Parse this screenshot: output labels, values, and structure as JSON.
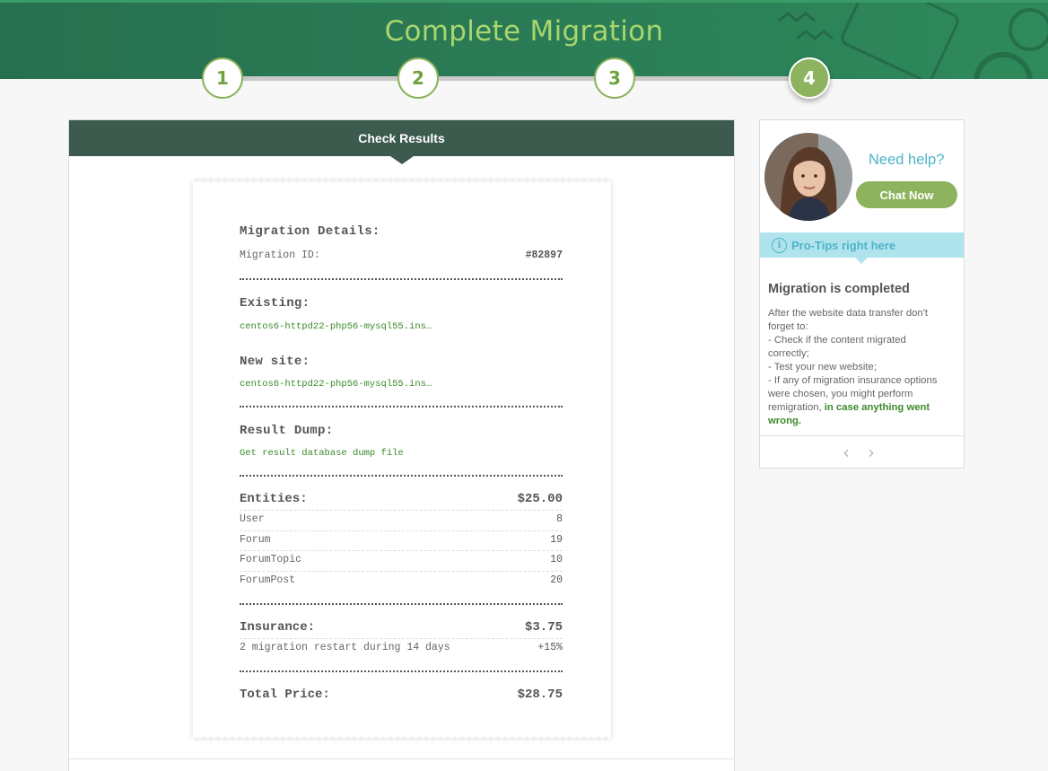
{
  "header": {
    "title": "Complete Migration"
  },
  "steps": [
    "1",
    "2",
    "3",
    "4"
  ],
  "panel": {
    "title": "Check Results"
  },
  "receipt": {
    "details_heading": "Migration Details:",
    "migration_id_label": "Migration ID:",
    "migration_id_value": "#82897",
    "existing_heading": "Existing:",
    "existing_link": "centos6-httpd22-php56-mysql55.ins…",
    "new_site_heading": "New site:",
    "new_site_link": "centos6-httpd22-php56-mysql55.ins…",
    "dump_heading": "Result Dump:",
    "dump_link": "Get result database dump file",
    "entities": {
      "label": "Entities:",
      "price": "$25.00",
      "rows": [
        {
          "name": "User",
          "count": "8"
        },
        {
          "name": "Forum",
          "count": "19"
        },
        {
          "name": "ForumTopic",
          "count": "10"
        },
        {
          "name": "ForumPost",
          "count": "20"
        }
      ]
    },
    "insurance": {
      "label": "Insurance:",
      "price": "$3.75",
      "detail": "2 migration restart during 14 days",
      "detail_value": "+15%"
    },
    "total": {
      "label": "Total Price:",
      "price": "$28.75"
    }
  },
  "sidebar": {
    "need_help": "Need help?",
    "chat_button": "Chat Now",
    "tips_label": "Pro-Tips right here",
    "tip_title": "Migration is completed",
    "tip_lines": [
      "After the website data transfer don't",
      "forget to:",
      "- Check if the content migrated",
      "correctly;",
      "- Test your new website;",
      "- If any of migration insurance options",
      "were chosen, you might perform"
    ],
    "tip_last_plain": "remigration, ",
    "tip_last_highlight": "in case anything went",
    "tip_final_highlight": "wrong."
  },
  "colors": {
    "accent_green": "#8db35e",
    "header_green": "#27704f",
    "link_green": "#3a8a2a",
    "help_blue": "#4fb3c9"
  }
}
